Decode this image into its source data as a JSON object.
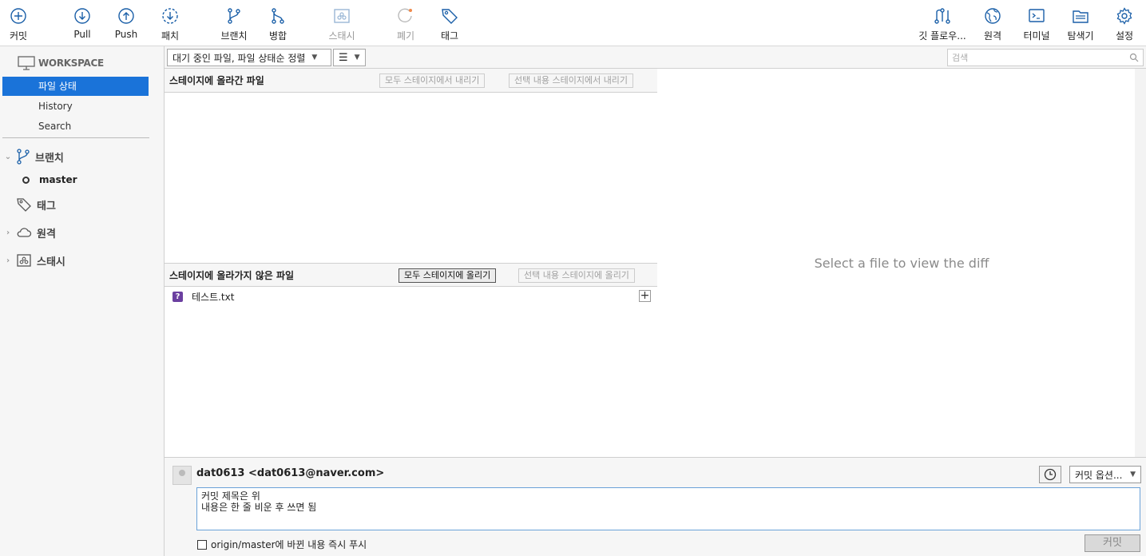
{
  "toolbar": {
    "commit": "커밋",
    "pull": "Pull",
    "push": "Push",
    "fetch": "패치",
    "branch": "브랜치",
    "merge": "병합",
    "stash": "스태시",
    "discard": "폐기",
    "tag": "태그",
    "gitflow": "깃 플로우...",
    "remote": "원격",
    "terminal": "터미널",
    "explorer": "탐색기",
    "settings": "설정"
  },
  "sidebar": {
    "workspace": "WORKSPACE",
    "items": [
      {
        "label": "파일 상태",
        "selected": true
      },
      {
        "label": "History",
        "selected": false
      },
      {
        "label": "Search",
        "selected": false
      }
    ],
    "branches_label": "브랜치",
    "current_branch": "master",
    "tags_label": "태그",
    "remotes_label": "원격",
    "stashes_label": "스태시"
  },
  "filebar": {
    "filter_value": "대기 중인 파일, 파일 상태순 정렬",
    "search_placeholder": "검색"
  },
  "staged": {
    "title": "스테이지에 올라간 파일",
    "unstage_all": "모두 스테이지에서 내리기",
    "unstage_selected": "선택 내용 스테이지에서 내리기"
  },
  "unstaged": {
    "title": "스테이지에 올라가지 않은 파일",
    "stage_all": "모두 스테이지에 올리기",
    "stage_selected": "선택 내용 스테이지에 올리기",
    "files": [
      {
        "name": "테스트.txt",
        "status": "untracked"
      }
    ]
  },
  "diff": {
    "placeholder": "Select a file to view the diff"
  },
  "commit": {
    "author": "dat0613 <dat0613@naver.com>",
    "options": "커밋 옵션...",
    "message_line1": "커밋 제목은 위",
    "message_line2": "",
    "message_line3": "내용은 한 줄 비운 후 쓰면 됨",
    "push_checkbox": "origin/master에 바뀐 내용 즉시 푸시",
    "push_checked": false,
    "commit_button": "커밋"
  },
  "colors": {
    "accent": "#1a73d9",
    "icon": "#1a5fa8",
    "untracked": "#6b3fa0"
  }
}
